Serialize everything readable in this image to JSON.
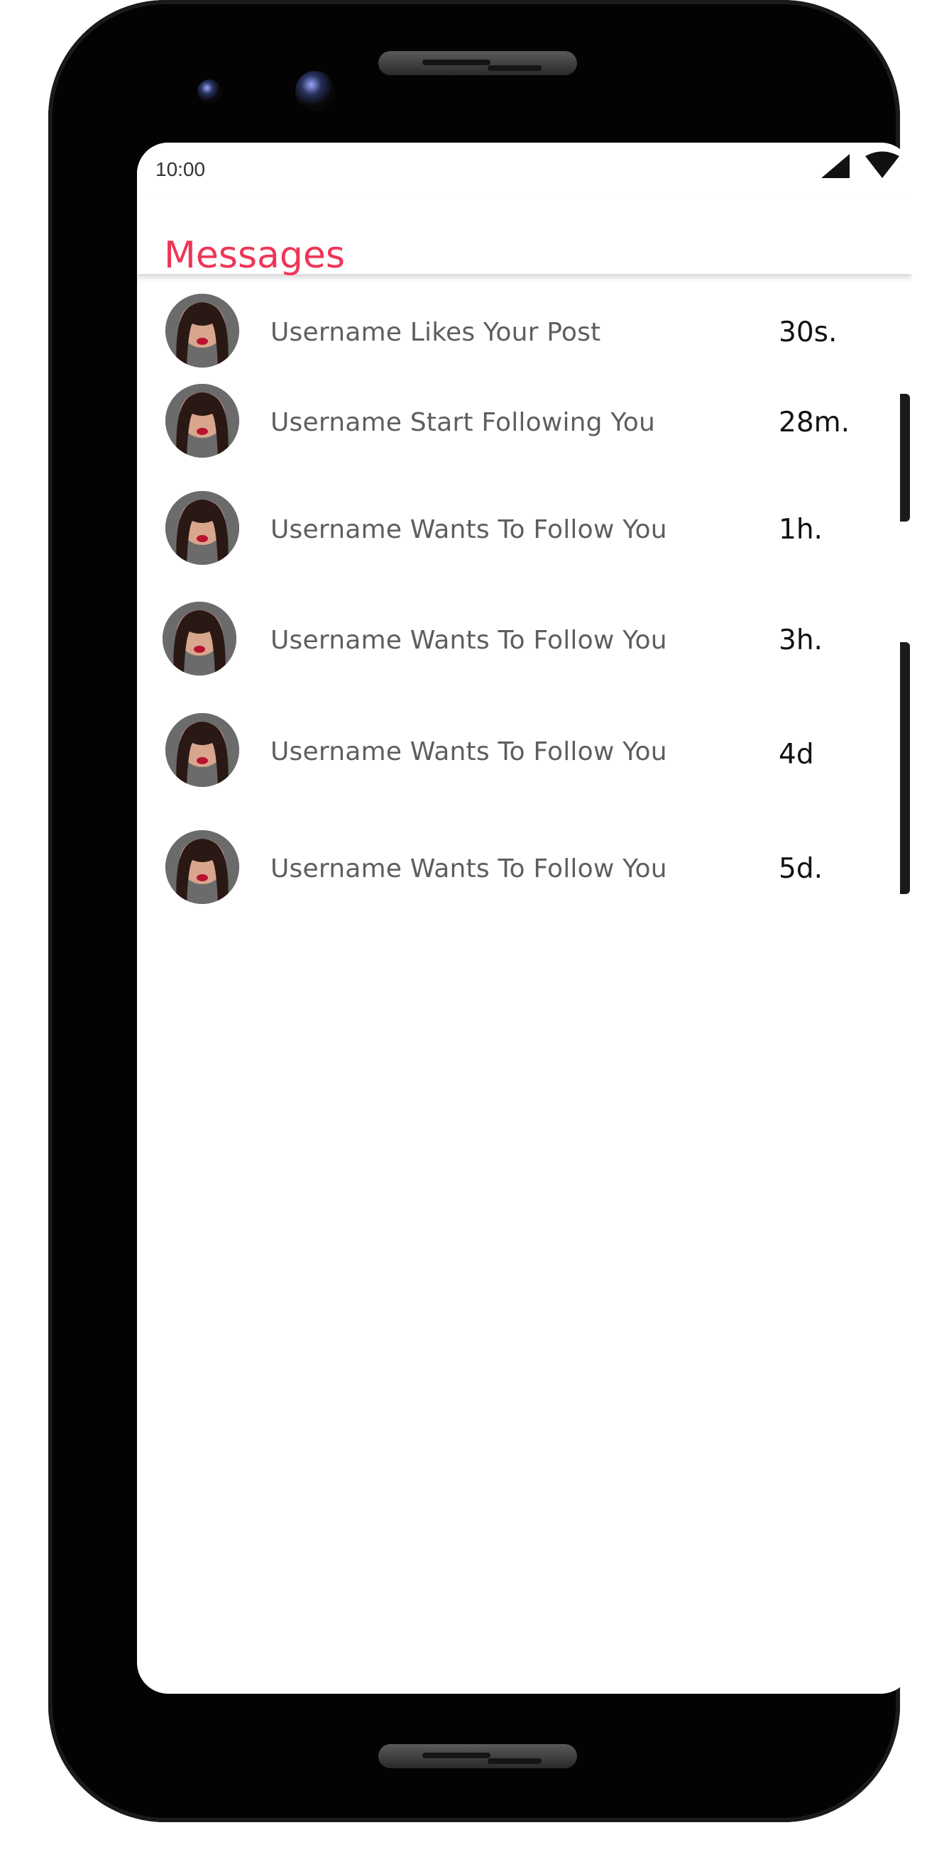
{
  "status_bar": {
    "time": "10:00",
    "icons": [
      "signal-icon",
      "wifi-icon"
    ]
  },
  "app_bar": {
    "title": "Messages",
    "accent_color": "#ef3558"
  },
  "notifications": [
    {
      "text": "Username Likes Your Post",
      "time": "30s.",
      "avatar": "avatar-photo"
    },
    {
      "text": "Username Start Following You",
      "time": "28m.",
      "avatar": "avatar-photo"
    },
    {
      "text": "Username Wants To Follow You",
      "time": "1h.",
      "avatar": "avatar-photo"
    },
    {
      "text": "Username Wants To Follow You",
      "time": "3h.",
      "avatar": "avatar-photo"
    },
    {
      "text": "Username Wants To Follow You",
      "time": "4d",
      "avatar": "avatar-photo"
    },
    {
      "text": "Username Wants To Follow You",
      "time": "5d.",
      "avatar": "avatar-photo"
    }
  ]
}
